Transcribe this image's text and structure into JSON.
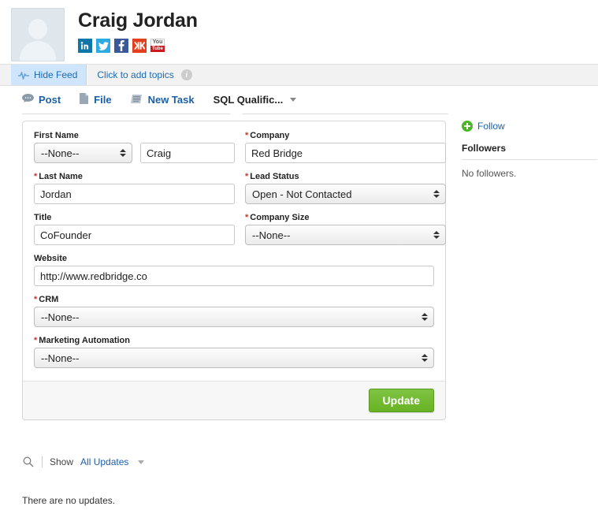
{
  "profile": {
    "name": "Craig Jordan",
    "avatar_alt": "user-placeholder-avatar",
    "social_links": [
      {
        "name": "linkedin",
        "glyph": "in"
      },
      {
        "name": "twitter",
        "glyph": "✉"
      },
      {
        "name": "facebook",
        "glyph": "f"
      },
      {
        "name": "klout",
        "glyph": "❯K"
      },
      {
        "name": "youtube",
        "glyph_top": "You",
        "glyph_bottom": "Tube"
      }
    ]
  },
  "feed_bar": {
    "hide_feed_label": "Hide Feed",
    "topics_label": "Click to add topics",
    "info_glyph": "i"
  },
  "publisher": {
    "tabs": [
      {
        "label": "Post",
        "icon": "chat-bubble-icon",
        "active": false
      },
      {
        "label": "File",
        "icon": "file-icon",
        "active": false
      },
      {
        "label": "New Task",
        "icon": "task-list-icon",
        "active": false
      },
      {
        "label": "SQL Qualific...",
        "icon": "caret-down-icon",
        "active": true
      }
    ]
  },
  "form": {
    "fields": {
      "salutation": {
        "label": "First Name",
        "value": "--None--",
        "required": false
      },
      "first_name": {
        "label": "First Name",
        "value": "Craig",
        "required": false
      },
      "company": {
        "label": "Company",
        "value": "Red Bridge",
        "required": true
      },
      "last_name": {
        "label": "Last Name",
        "value": "Jordan",
        "required": true
      },
      "lead_status": {
        "label": "Lead Status",
        "value": "Open - Not Contacted",
        "required": true
      },
      "title": {
        "label": "Title",
        "value": "CoFounder",
        "required": false
      },
      "company_size": {
        "label": "Company Size",
        "value": "--None--",
        "required": true
      },
      "website": {
        "label": "Website",
        "value": "http://www.redbridge.co",
        "required": false
      },
      "crm": {
        "label": "CRM",
        "value": "--None--",
        "required": true
      },
      "marketing_automation": {
        "label": "Marketing Automation",
        "value": "--None--",
        "required": true
      }
    },
    "required_marker": "*",
    "update_button": "Update"
  },
  "right_rail": {
    "follow_label": "Follow",
    "followers_title": "Followers",
    "followers_empty": "No followers."
  },
  "updates": {
    "show_label": "Show",
    "filter_label": "All Updates",
    "empty_message": "There are no updates."
  },
  "colors": {
    "link": "#1b5faa",
    "required": "#c23934",
    "update_button": "#68b324",
    "hide_feed_bg": "#cfe5fb",
    "follow_plus": "#4cb527"
  }
}
